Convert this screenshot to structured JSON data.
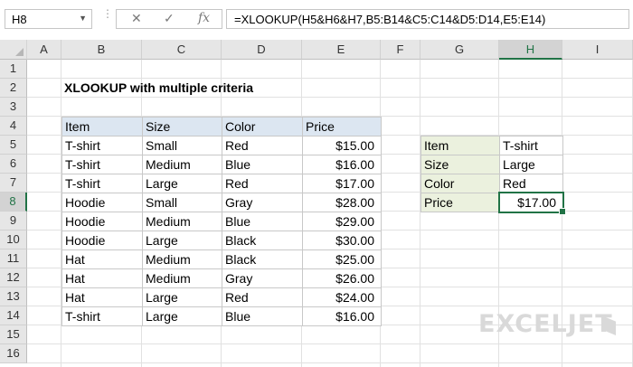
{
  "formula_bar": {
    "name_box": "H8",
    "cancel_icon": "✕",
    "confirm_icon": "✓",
    "fx_label": "fx",
    "formula": "=XLOOKUP(H5&H6&H7,B5:B14&C5:C14&D5:D14,E5:E14)"
  },
  "columns": [
    "A",
    "B",
    "C",
    "D",
    "E",
    "F",
    "G",
    "H",
    "I"
  ],
  "selected_column": "H",
  "rows": [
    "1",
    "2",
    "3",
    "4",
    "5",
    "6",
    "7",
    "8",
    "9",
    "10",
    "11",
    "12",
    "13",
    "14",
    "15",
    "16"
  ],
  "selected_row": "8",
  "title": "XLOOKUP with multiple criteria",
  "table": {
    "headers": [
      "Item",
      "Size",
      "Color",
      "Price"
    ],
    "rows": [
      [
        "T-shirt",
        "Small",
        "Red",
        "$15.00"
      ],
      [
        "T-shirt",
        "Medium",
        "Blue",
        "$16.00"
      ],
      [
        "T-shirt",
        "Large",
        "Red",
        "$17.00"
      ],
      [
        "Hoodie",
        "Small",
        "Gray",
        "$28.00"
      ],
      [
        "Hoodie",
        "Medium",
        "Blue",
        "$29.00"
      ],
      [
        "Hoodie",
        "Large",
        "Black",
        "$30.00"
      ],
      [
        "Hat",
        "Medium",
        "Black",
        "$25.00"
      ],
      [
        "Hat",
        "Medium",
        "Gray",
        "$26.00"
      ],
      [
        "Hat",
        "Large",
        "Red",
        "$24.00"
      ],
      [
        "T-shirt",
        "Large",
        "Blue",
        "$16.00"
      ]
    ]
  },
  "lookup": [
    {
      "label": "Item",
      "value": "T-shirt"
    },
    {
      "label": "Size",
      "value": "Large"
    },
    {
      "label": "Color",
      "value": "Red"
    },
    {
      "label": "Price",
      "value": "$17.00"
    }
  ],
  "logo_text": "EXCELJET",
  "colors": {
    "accent": "#217346",
    "header_fill": "#dce6f1",
    "label_fill": "#ebf1de"
  }
}
